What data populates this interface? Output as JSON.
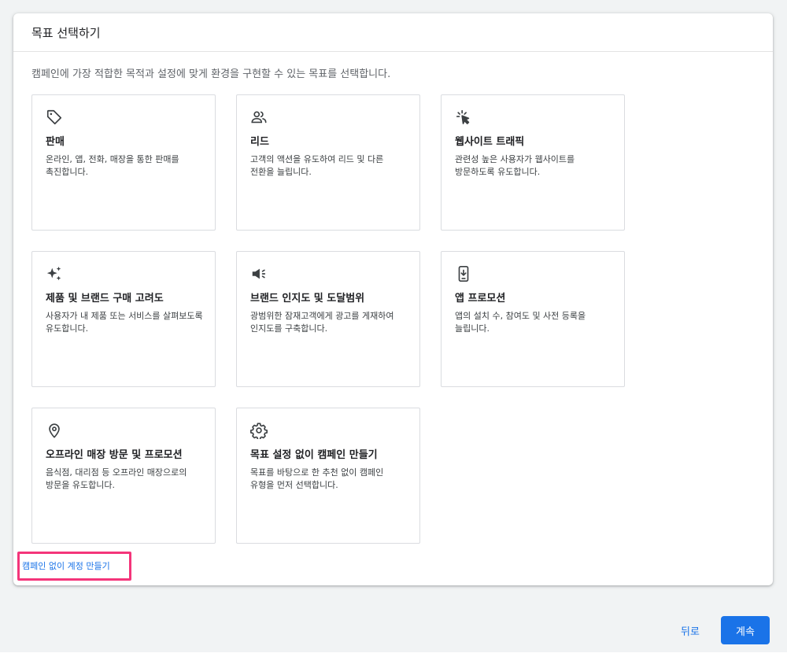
{
  "dialog": {
    "title": "목표 선택하기",
    "description": "캠페인에 가장 적합한 목적과 설정에 맞게 환경을 구현할 수 있는 목표를 선택합니다."
  },
  "goals": [
    {
      "icon": "tag-icon",
      "title": "판매",
      "description": "온라인, 앱, 전화, 매장을 통한 판매를 촉진합니다."
    },
    {
      "icon": "people-icon",
      "title": "리드",
      "description": "고객의 액션을 유도하여 리드 및 다른 전환을 늘립니다."
    },
    {
      "icon": "cursor-click-icon",
      "title": "웹사이트 트래픽",
      "description": "관련성 높은 사용자가 웹사이트를 방문하도록 유도합니다."
    },
    {
      "icon": "sparkle-icon",
      "title": "제품 및 브랜드 구매 고려도",
      "description": "사용자가 내 제품 또는 서비스를 살펴보도록 유도합니다."
    },
    {
      "icon": "speaker-icon",
      "title": "브랜드 인지도 및 도달범위",
      "description": "광범위한 잠재고객에게 광고를 게재하여 인지도를 구축합니다."
    },
    {
      "icon": "phone-download-icon",
      "title": "앱 프로모션",
      "description": "앱의 설치 수, 참여도 및 사전 등록을 늘립니다."
    },
    {
      "icon": "location-pin-icon",
      "title": "오프라인 매장 방문 및 프로모션",
      "description": "음식점, 대리점 등 오프라인 매장으로의 방문을 유도합니다."
    },
    {
      "icon": "gear-icon",
      "title": "목표 설정 없이 캠페인 만들기",
      "description": "목표를 바탕으로 한 추천 없이 캠페인 유형을 먼저 선택합니다."
    }
  ],
  "links": {
    "create_account_without_campaign": "캠페인 없이 계정 만들기"
  },
  "footer": {
    "back_label": "뒤로",
    "continue_label": "계속"
  },
  "colors": {
    "accent": "#1a73e8",
    "highlight_box": "#f4357a"
  }
}
